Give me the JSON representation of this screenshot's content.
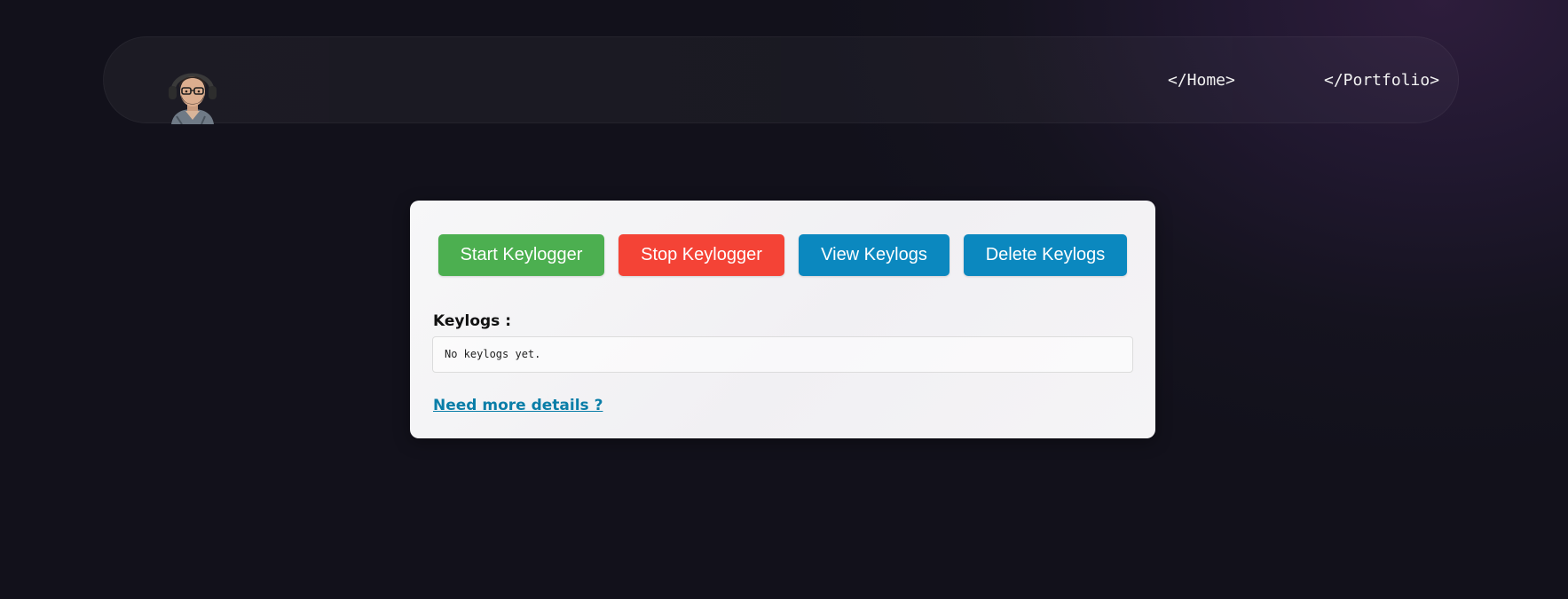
{
  "nav": {
    "avatar_icon": "memoji-avatar-icon",
    "home_label": "</Home>",
    "portfolio_label": "</Portfolio>"
  },
  "controls": {
    "start_label": "Start Keylogger",
    "stop_label": "Stop Keylogger",
    "view_label": "View Keylogs",
    "delete_label": "Delete Keylogs"
  },
  "keylogs": {
    "heading": "Keylogs :",
    "content": "No keylogs yet."
  },
  "details_link": "Need more details ?",
  "colors": {
    "start": "#4caf50",
    "stop": "#f44336",
    "view": "#0b88bf",
    "delete": "#0b88bf",
    "link": "#0a7ea8"
  }
}
